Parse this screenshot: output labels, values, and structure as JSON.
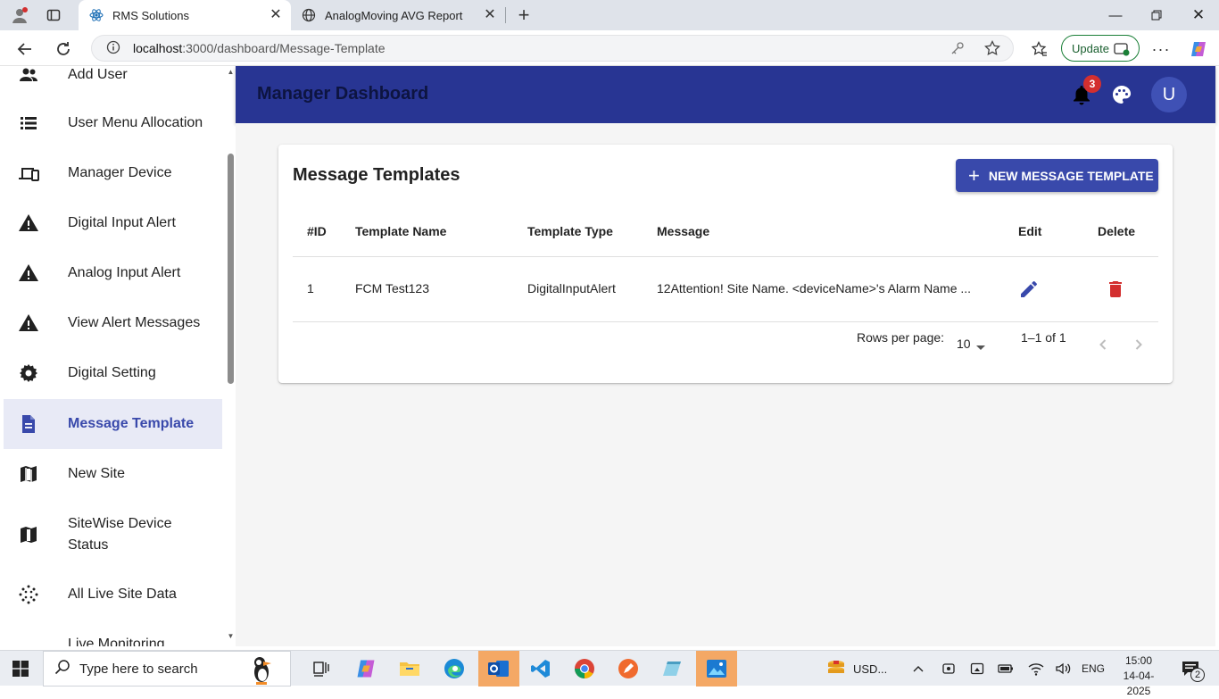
{
  "browser": {
    "tabs": [
      {
        "title": "RMS Solutions",
        "active": true
      },
      {
        "title": "AnalogMoving AVG Report",
        "active": false
      }
    ],
    "url_host": "localhost",
    "url_path": ":3000/dashboard/Message-Template",
    "update_label": "Update"
  },
  "sidebar": {
    "items": [
      {
        "label": "Add User",
        "icon": "people-icon"
      },
      {
        "label": "User Menu Allocation",
        "icon": "list-icon"
      },
      {
        "label": "Manager Device",
        "icon": "devices-icon"
      },
      {
        "label": "Digital Input Alert",
        "icon": "warning-icon"
      },
      {
        "label": "Analog Input Alert",
        "icon": "warning-icon"
      },
      {
        "label": "View Alert Messages",
        "icon": "warning-icon"
      },
      {
        "label": "Digital Setting",
        "icon": "gear-icon"
      },
      {
        "label": "Message Template",
        "icon": "document-icon",
        "selected": true
      },
      {
        "label": "New Site",
        "icon": "map-icon"
      },
      {
        "label": "SiteWise Device Status",
        "label_line1": "SiteWise Device",
        "label_line2": "Status",
        "icon": "map-icon"
      },
      {
        "label": "All Live Site Data",
        "icon": "scatter-icon"
      },
      {
        "label": "Live Monitoring",
        "icon": "monitor-icon"
      }
    ]
  },
  "header": {
    "title": "Manager Dashboard",
    "notification_count": "3",
    "avatar_letter": "U"
  },
  "card": {
    "title": "Message Templates",
    "new_button_label": "NEW MESSAGE TEMPLATE",
    "columns": [
      "#ID",
      "Template Name",
      "Template Type",
      "Message",
      "Edit",
      "Delete"
    ],
    "rows": [
      {
        "id": "1",
        "name": "FCM Test123",
        "type": "DigitalInputAlert",
        "message": "12Attention! Site Name. <deviceName>'s Alarm Name ..."
      }
    ],
    "pagination": {
      "rows_per_page_label": "Rows per page:",
      "rows_per_page": "10",
      "range": "1–1 of 1"
    }
  },
  "taskbar": {
    "search_placeholder": "Type here to search",
    "weather": "USD...",
    "language": "ENG",
    "time": "15:00",
    "date": "14-04-2025",
    "notif_count": "2"
  },
  "colors": {
    "primary": "#3949ab",
    "appbar": "#283593",
    "danger": "#d32f2f"
  }
}
